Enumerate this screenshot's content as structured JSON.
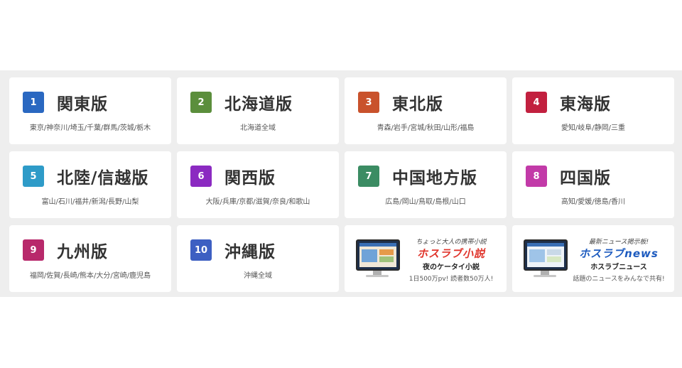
{
  "regions": [
    {
      "num": "1",
      "title": "関東版",
      "areas": "東京/神奈川/埼玉/千葉/群馬/茨城/栃木",
      "color": "#2a68c1"
    },
    {
      "num": "2",
      "title": "北海道版",
      "areas": "北海道全域",
      "color": "#5b8e3c"
    },
    {
      "num": "3",
      "title": "東北版",
      "areas": "青森/岩手/宮城/秋田/山形/福島",
      "color": "#c9522c"
    },
    {
      "num": "4",
      "title": "東海版",
      "areas": "愛知/岐阜/静岡/三重",
      "color": "#c2203f"
    },
    {
      "num": "5",
      "title": "北陸/信越版",
      "areas": "富山/石川/福井/新潟/長野/山梨",
      "color": "#2e9bc8"
    },
    {
      "num": "6",
      "title": "関西版",
      "areas": "大阪/兵庫/京都/滋賀/奈良/和歌山",
      "color": "#8b2ac1"
    },
    {
      "num": "7",
      "title": "中国地方版",
      "areas": "広島/岡山/鳥取/島根/山口",
      "color": "#3b8c63"
    },
    {
      "num": "8",
      "title": "四国版",
      "areas": "高知/愛媛/徳島/香川",
      "color": "#c23aa8"
    },
    {
      "num": "9",
      "title": "九州版",
      "areas": "福岡/佐賀/長崎/熊本/大分/宮崎/鹿児島",
      "color": "#b8296b"
    },
    {
      "num": "10",
      "title": "沖縄版",
      "areas": "沖縄全域",
      "color": "#3d5fc2"
    }
  ],
  "ads": [
    {
      "tagline": "ちょっと大人の携帯小説",
      "logo": "ホスラブ小説",
      "subtitle": "夜のケータイ小説",
      "note": "1日500万pv! 読者数50万人!",
      "logo_color": "#e0342b"
    },
    {
      "tagline": "最新ニュース掲示板!",
      "logo": "ホスラブnews",
      "subtitle": "ホスラブニュース",
      "note": "話題のニュースをみんなで共有!",
      "logo_color": "#1d5bbf"
    }
  ]
}
